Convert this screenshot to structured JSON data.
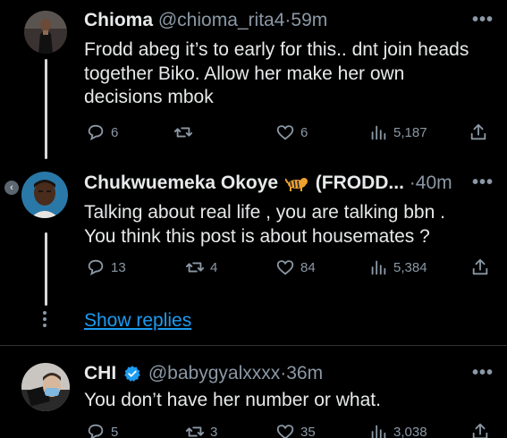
{
  "tweets": [
    {
      "name": "Chioma",
      "handle": "@chioma_rita4",
      "time": "59m",
      "text_lines": [
        "Frodd abeg it’s to early for this.. dnt join heads",
        "together Biko. Allow her make her own",
        "decisions mbok"
      ],
      "replies": "6",
      "retweets": "",
      "likes": "6",
      "views": "5,187"
    },
    {
      "name": "Chukwuemeka Okoye",
      "name_suffix": "(FRODD...",
      "time": "40m",
      "text_lines": [
        "Talking about real life , you are talking bbn .",
        "You think this post is about housemates ?"
      ],
      "replies": "13",
      "retweets": "4",
      "likes": "84",
      "views": "5,384"
    },
    {
      "name": "CHI",
      "handle": "@babygyalxxxx",
      "time": "36m",
      "text_lines": [
        "You don’t have her number or what."
      ],
      "replies": "5",
      "retweets": "3",
      "likes": "35",
      "views": "3,038"
    }
  ],
  "show_replies": "Show replies",
  "more_glyph": "•••",
  "dot_sep": "·",
  "colors": {
    "accent": "#1d9bf0",
    "muted": "#8b98a5",
    "text": "#e7e9ea",
    "background": "#000000",
    "verified": "#1d9bf0"
  },
  "icons": [
    "reply-icon",
    "retweet-icon",
    "like-icon",
    "views-icon",
    "share-icon",
    "more-icon",
    "tiger-emoji-icon",
    "verified-badge-icon"
  ]
}
